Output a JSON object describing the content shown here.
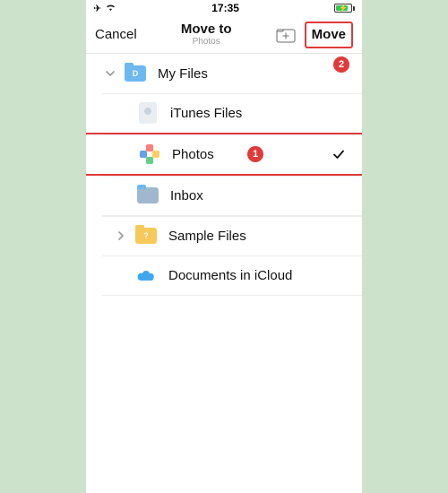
{
  "status": {
    "time": "17:35"
  },
  "nav": {
    "cancel": "Cancel",
    "title": "Move to",
    "subtitle": "Photos",
    "move": "Move"
  },
  "annotations": {
    "row_badge": "1",
    "move_badge": "2"
  },
  "rows": {
    "myfiles": "My Files",
    "itunes": "iTunes Files",
    "photos": "Photos",
    "inbox": "Inbox",
    "sample": "Sample Files",
    "icloud": "Documents in iCloud"
  }
}
